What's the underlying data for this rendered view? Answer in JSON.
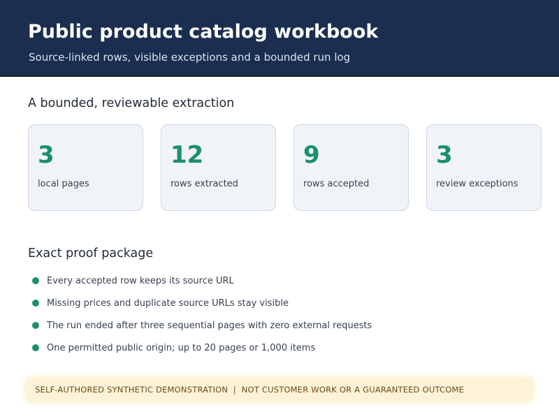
{
  "header": {
    "title": "Public product catalog workbook",
    "subtitle": "Source-linked rows, visible exceptions and a bounded run log"
  },
  "summary": {
    "title": "A bounded, reviewable extraction",
    "cards": [
      {
        "value": "3",
        "label": "local pages"
      },
      {
        "value": "12",
        "label": "rows extracted"
      },
      {
        "value": "9",
        "label": "rows accepted"
      },
      {
        "value": "3",
        "label": "review exceptions"
      }
    ]
  },
  "proof": {
    "title": "Exact proof package",
    "items": [
      "Every accepted row keeps its source URL",
      "Missing prices and duplicate source URLs stay visible",
      "The run ended after three sequential pages with zero external requests",
      "One permitted public origin; up to 20 pages or 1,000 items"
    ]
  },
  "footer": {
    "disclaimer": "SELF-AUTHORED SYNTHETIC DEMONSTRATION  |  NOT CUSTOMER WORK OR A GUARANTEED OUTCOME"
  },
  "colors": {
    "header_bg": "#1b2e4f",
    "accent_green": "#1a8f6e",
    "card_bg": "#f0f4f8",
    "banner_bg": "#fdf3d8"
  }
}
